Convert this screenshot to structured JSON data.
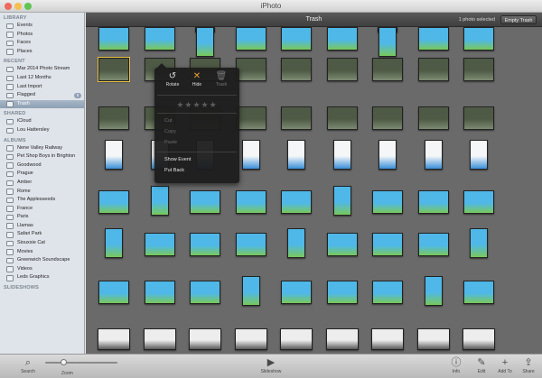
{
  "window": {
    "title": "iPhoto",
    "traffic_lights": [
      "#ed6a5e",
      "#f5bf4f",
      "#61c554"
    ]
  },
  "sidebar": {
    "sections": [
      {
        "title": "LIBRARY",
        "items": [
          {
            "label": "Events",
            "icon": "events-icon"
          },
          {
            "label": "Photos",
            "icon": "photos-icon"
          },
          {
            "label": "Faces",
            "icon": "faces-icon"
          },
          {
            "label": "Places",
            "icon": "places-icon"
          }
        ]
      },
      {
        "title": "RECENT",
        "items": [
          {
            "label": "Mar 2014 Photo Stream",
            "icon": "photo-stream-icon"
          },
          {
            "label": "Last 12 Months",
            "icon": "calendar-icon"
          },
          {
            "label": "Last Import",
            "icon": "import-icon"
          },
          {
            "label": "Flagged",
            "icon": "flag-icon",
            "badge": "5"
          },
          {
            "label": "Trash",
            "icon": "trash-icon",
            "selected": true
          }
        ]
      },
      {
        "title": "SHARED",
        "items": [
          {
            "label": "iCloud",
            "icon": "icloud-icon"
          },
          {
            "label": "Lou Hattersley",
            "icon": "shared-stream-icon"
          }
        ]
      },
      {
        "title": "ALBUMS",
        "items": [
          {
            "label": "Nene Valley Railway",
            "icon": "album-icon"
          },
          {
            "label": "Pet Shop Boys in Brighton",
            "icon": "album-icon"
          },
          {
            "label": "Goodwood",
            "icon": "album-icon"
          },
          {
            "label": "Prague",
            "icon": "album-icon"
          },
          {
            "label": "Amber",
            "icon": "album-icon"
          },
          {
            "label": "Rome",
            "icon": "album-icon"
          },
          {
            "label": "The Applesseeds",
            "icon": "album-icon"
          },
          {
            "label": "France",
            "icon": "album-icon"
          },
          {
            "label": "Paris",
            "icon": "album-icon"
          },
          {
            "label": "Llamas",
            "icon": "album-icon"
          },
          {
            "label": "Safari Park",
            "icon": "album-icon"
          },
          {
            "label": "Siouxsie Cat",
            "icon": "album-icon"
          },
          {
            "label": "Movies",
            "icon": "album-icon"
          },
          {
            "label": "Greenwich Soundscape",
            "icon": "album-icon"
          },
          {
            "label": "Videos",
            "icon": "album-icon"
          },
          {
            "label": "Leds Graphics",
            "icon": "album-icon"
          }
        ]
      },
      {
        "title": "SLIDESHOWS",
        "items": []
      }
    ]
  },
  "header": {
    "view_title": "Trash",
    "selection_status": "1 photo selected",
    "empty_trash_label": "Empty Trash"
  },
  "popup": {
    "actions": [
      {
        "label": "Rotate",
        "icon": "rotate-icon",
        "glyph": "↺",
        "enabled": true
      },
      {
        "label": "Hide",
        "icon": "hide-icon",
        "glyph": "✕",
        "enabled": true,
        "accent": "#f0a23a"
      },
      {
        "label": "Trash",
        "icon": "trash-icon",
        "glyph": "🗑",
        "enabled": false
      }
    ],
    "rating_stars": "★★★★★",
    "rating_value": 0,
    "menu_items": [
      {
        "label": "Cut",
        "enabled": false
      },
      {
        "label": "Copy",
        "enabled": false
      },
      {
        "label": "Paste",
        "enabled": false
      },
      {
        "label": "Show Event",
        "enabled": true
      },
      {
        "label": "Put Back",
        "enabled": true
      }
    ]
  },
  "toolbar": {
    "left": [
      {
        "label": "Search",
        "icon": "search-icon",
        "glyph": "⌕"
      },
      {
        "label": "Zoom",
        "icon": "zoom-icon",
        "glyph": ""
      }
    ],
    "center": [
      {
        "label": "Slideshow",
        "icon": "slideshow-icon",
        "glyph": "▶"
      }
    ],
    "right": [
      {
        "label": "Info",
        "icon": "info-icon",
        "glyph": "ⓘ"
      },
      {
        "label": "Edit",
        "icon": "edit-icon",
        "glyph": "✎"
      },
      {
        "label": "Add To",
        "icon": "add-icon",
        "glyph": "+"
      },
      {
        "label": "Share",
        "icon": "share-icon",
        "glyph": "⇪"
      }
    ],
    "zoom_level": 0.25
  },
  "colors": {
    "selection": "#e9c23b",
    "grid_bg": "#6a6a6a"
  },
  "thumbnails": {
    "selected_index": 9,
    "kinds": [
      "partial",
      "partial",
      "partial",
      "partial",
      "partial",
      "partial",
      "partial",
      "partial",
      "partial",
      "photo",
      "photo",
      "photo",
      "photo",
      "photo",
      "photo",
      "photo",
      "photo",
      "photo",
      "photo",
      "photo",
      "photo",
      "photo",
      "photo",
      "photo",
      "photo",
      "photo",
      "photo",
      "screen",
      "screen",
      "screen",
      "screen",
      "screen",
      "screen",
      "screen",
      "screen",
      "screen",
      "game",
      "game",
      "game",
      "game",
      "game",
      "game",
      "game",
      "game",
      "game",
      "game",
      "game",
      "game",
      "game",
      "game",
      "game",
      "game",
      "game",
      "game",
      "game",
      "game",
      "game",
      "game",
      "game",
      "game",
      "game",
      "game",
      "game",
      "game",
      "game",
      "game",
      "game",
      "game",
      "game",
      "game",
      "game",
      "game",
      "mixed",
      "mixed",
      "mixed",
      "mixed",
      "mixed",
      "mixed",
      "mixed",
      "mixed",
      "mixed"
    ]
  }
}
